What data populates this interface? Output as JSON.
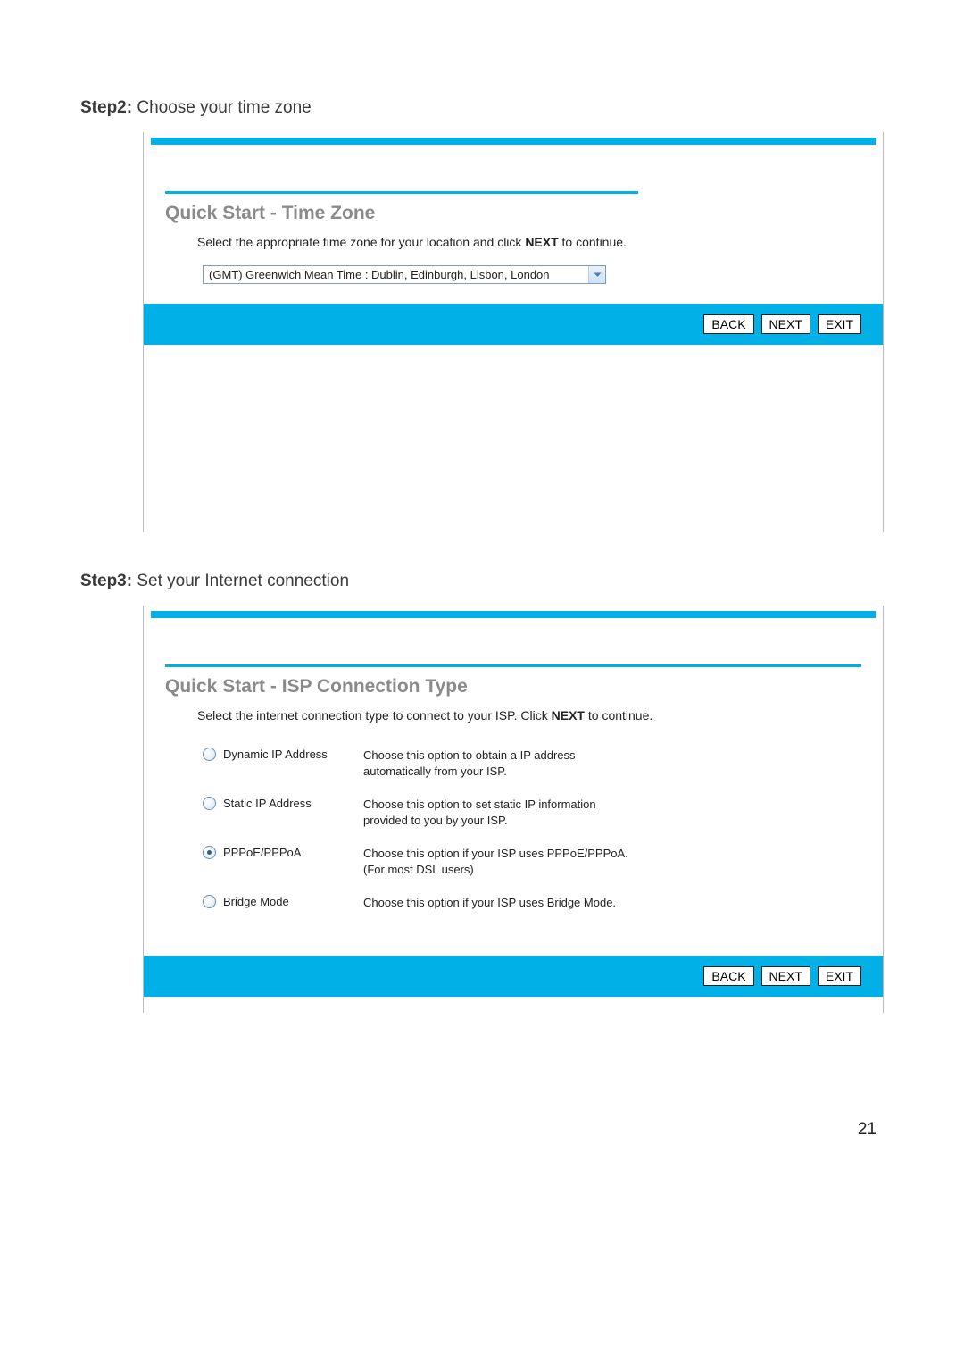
{
  "step2": {
    "bold": "Step2:",
    "text": "Choose your time zone",
    "title": "Quick Start - Time Zone",
    "instr_pre": "Select the appropriate time zone for your location and click ",
    "instr_bold": "NEXT",
    "instr_post": " to continue.",
    "timezone_value": "(GMT) Greenwich Mean Time : Dublin, Edinburgh, Lisbon, London",
    "buttons": {
      "back": "BACK",
      "next": "NEXT",
      "exit": "EXIT"
    }
  },
  "step3": {
    "bold": "Step3:",
    "text": "Set your Internet connection",
    "title": "Quick Start - ISP Connection Type",
    "instr_pre": "Select the internet connection type to connect to your ISP. Click ",
    "instr_bold": "NEXT",
    "instr_post": " to continue.",
    "options": [
      {
        "label": "Dynamic IP Address",
        "desc": "Choose this option to obtain a IP address automatically from your ISP.",
        "checked": false
      },
      {
        "label": "Static IP Address",
        "desc": "Choose this option to set static IP information provided to you by your ISP.",
        "checked": false
      },
      {
        "label": "PPPoE/PPPoA",
        "desc": "Choose this option if your ISP uses PPPoE/PPPoA. (For most DSL users)",
        "checked": true
      },
      {
        "label": "Bridge Mode",
        "desc": "Choose this option if your ISP uses Bridge Mode.",
        "checked": false
      }
    ],
    "buttons": {
      "back": "BACK",
      "next": "NEXT",
      "exit": "EXIT"
    }
  },
  "page_number": "21"
}
